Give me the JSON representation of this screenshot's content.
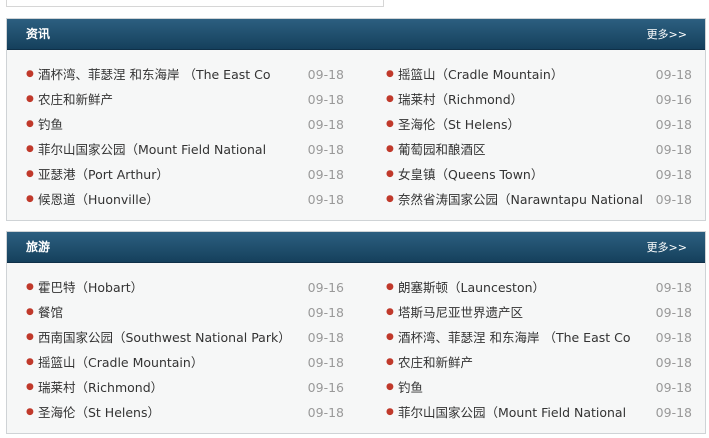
{
  "sections": [
    {
      "title": "资讯",
      "more": "更多>>",
      "left": [
        {
          "title": "酒杯湾、菲瑟涅 和东海岸 （The East Co",
          "date": "09-18"
        },
        {
          "title": "农庄和新鲜产",
          "date": "09-18"
        },
        {
          "title": "钓鱼",
          "date": "09-18"
        },
        {
          "title": "菲尔山国家公园（Mount Field National",
          "date": "09-18"
        },
        {
          "title": "亚瑟港（Port Arthur）",
          "date": "09-18"
        },
        {
          "title": "候恩道（Huonville）",
          "date": "09-18"
        }
      ],
      "right": [
        {
          "title": "摇篮山（Cradle Mountain）",
          "date": "09-18"
        },
        {
          "title": "瑞莱村（Richmond）",
          "date": "09-16"
        },
        {
          "title": "圣海伦（St Helens）",
          "date": "09-18"
        },
        {
          "title": "葡萄园和酿酒区",
          "date": "09-18"
        },
        {
          "title": "女皇镇（Queens Town）",
          "date": "09-18"
        },
        {
          "title": "奈然省涛国家公园（Narawntapu National",
          "date": "09-18"
        }
      ]
    },
    {
      "title": "旅游",
      "more": "更多>>",
      "left": [
        {
          "title": "霍巴特（Hobart）",
          "date": "09-16"
        },
        {
          "title": "餐馆",
          "date": "09-18"
        },
        {
          "title": "西南国家公园（Southwest National Park）",
          "date": "09-18"
        },
        {
          "title": "摇篮山（Cradle Mountain）",
          "date": "09-18"
        },
        {
          "title": "瑞莱村（Richmond）",
          "date": "09-16"
        },
        {
          "title": "圣海伦（St Helens）",
          "date": "09-18"
        }
      ],
      "right": [
        {
          "title": "朗塞斯顿（Launceston）",
          "date": "09-18"
        },
        {
          "title": "塔斯马尼亚世界遗产区",
          "date": "09-18"
        },
        {
          "title": "酒杯湾、菲瑟涅 和东海岸 （The East Co",
          "date": "09-18"
        },
        {
          "title": "农庄和新鲜产",
          "date": "09-18"
        },
        {
          "title": "钓鱼",
          "date": "09-18"
        },
        {
          "title": "菲尔山国家公园（Mount Field National",
          "date": "09-18"
        }
      ]
    }
  ],
  "colors": {
    "header_bg": "#1d4a68",
    "bullet": "#c0392b",
    "date": "#999999"
  }
}
